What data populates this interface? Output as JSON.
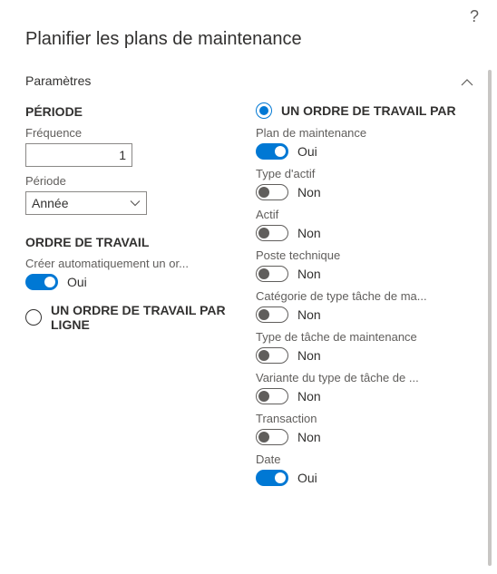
{
  "help_tooltip": "?",
  "title": "Planifier les plans de maintenance",
  "section_header": "Paramètres",
  "labels": {
    "oui": "Oui",
    "non": "Non"
  },
  "period": {
    "heading": "PÉRIODE",
    "frequency_label": "Fréquence",
    "frequency_value": "1",
    "period_label": "Période",
    "period_value": "Année"
  },
  "work_order": {
    "heading": "ORDRE DE TRAVAIL",
    "auto_create_label": "Créer automatiquement un or...",
    "auto_create_on": true
  },
  "radio_per_line": {
    "label": "UN ORDRE DE TRAVAIL PAR LIGNE",
    "selected": false
  },
  "radio_per": {
    "label": "UN ORDRE DE TRAVAIL PAR",
    "selected": true
  },
  "per_options": [
    {
      "label": "Plan de maintenance",
      "on": true
    },
    {
      "label": "Type d'actif",
      "on": false
    },
    {
      "label": "Actif",
      "on": false
    },
    {
      "label": "Poste technique",
      "on": false
    },
    {
      "label": "Catégorie de type tâche de ma...",
      "on": false
    },
    {
      "label": "Type de tâche de maintenance",
      "on": false
    },
    {
      "label": "Variante du type de tâche de ...",
      "on": false
    },
    {
      "label": "Transaction",
      "on": false
    },
    {
      "label": "Date",
      "on": true
    }
  ]
}
